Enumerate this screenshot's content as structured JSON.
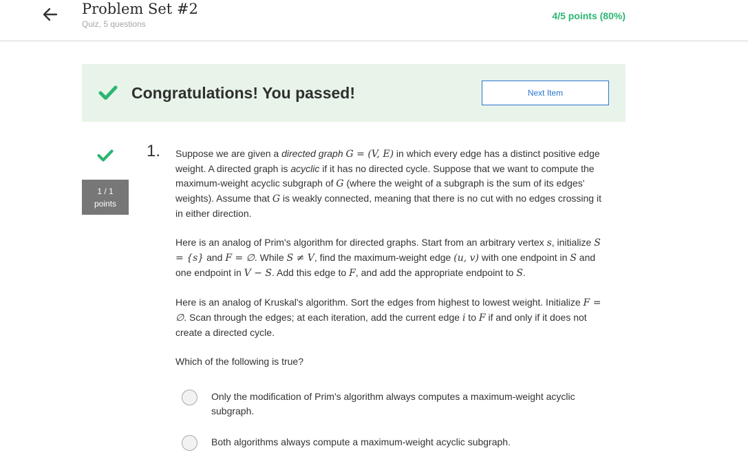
{
  "header": {
    "back_icon": "arrow-left-icon",
    "title": "Problem Set #2",
    "subtitle": "Quiz, 5 questions",
    "score": "4/5 points (80%)"
  },
  "banner": {
    "icon": "checkmark-icon",
    "message": "Congratulations! You passed!",
    "next_label": "Next Item"
  },
  "question": {
    "number": "1.",
    "points_line1": "1 / 1",
    "points_line2": "points",
    "p1": {
      "t1": "Suppose we are given a ",
      "em1": "directed graph",
      "m1": "G = (V, E)",
      "t2": " in which every edge has a distinct positive edge weight. A directed graph is ",
      "em2": "acyclic",
      "t3": " if it has no directed cycle. Suppose that we want to compute the maximum-weight acyclic subgraph of ",
      "m2": "G",
      "t4": " (where the weight of a subgraph is the sum of its edges' weights). Assume that ",
      "m3": "G",
      "t5": " is weakly connected, meaning that there is no cut with no edges crossing it in either direction."
    },
    "p2": {
      "t1": "Here is an analog of Prim's algorithm for directed graphs. Start from an arbitrary vertex ",
      "m1": "s",
      "t2": ", initialize ",
      "m2": "S = {s}",
      "t3": " and ",
      "m3": "F = ∅",
      "t4": ". While ",
      "m4": "S ≠ V",
      "t5": ", find the maximum-weight edge ",
      "m5": "(u, v)",
      "t6": " with one endpoint in ",
      "m6": "S",
      "t7": " and one endpoint in ",
      "m7": "V − S",
      "t8": ". Add this edge to ",
      "m8": "F",
      "t9": ", and add the appropriate endpoint to ",
      "m9": "S",
      "t10": "."
    },
    "p3": {
      "t1": "Here is an analog of Kruskal's algorithm. Sort the edges from highest to lowest weight. Initialize ",
      "m1": "F = ∅",
      "t2": ". Scan through the edges; at each iteration, add the current edge ",
      "m2": "i",
      "t3": " to ",
      "m3": "F",
      "t4": " if and only if it does not create a directed cycle."
    },
    "prompt": "Which of the following is true?",
    "options": [
      {
        "label": "Only the modification of Prim's algorithm always computes a maximum-weight acyclic subgraph."
      },
      {
        "label": "Both algorithms always compute a maximum-weight acyclic subgraph."
      }
    ]
  },
  "colors": {
    "accent_green": "#2bb673",
    "banner_bg": "#e8f4e9",
    "link_blue": "#2a73cc",
    "points_bg": "#777777"
  }
}
